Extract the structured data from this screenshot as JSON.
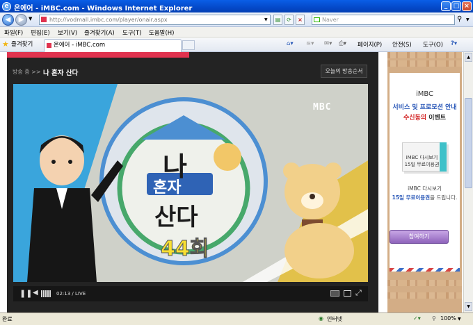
{
  "window": {
    "title": "온에어 - iMBC.com - Windows Internet Explorer"
  },
  "address": {
    "url": "http://vodmall.imbc.com/player/onair.aspx",
    "search_placeholder": "Naver"
  },
  "menu": [
    "파일(F)",
    "편집(E)",
    "보기(V)",
    "즐겨찾기(A)",
    "도구(T)",
    "도움말(H)"
  ],
  "favorites": {
    "label": "즐겨찾기",
    "tab_title": "온에어 - iMBC.com"
  },
  "commandbar": {
    "page": "페이지(P)",
    "safety": "안전(S)",
    "tools": "도구(O)"
  },
  "player": {
    "breadcrumb": "방송 중 >>",
    "show_title": "나 혼자 산다",
    "schedule_button": "오늘의 방송순서",
    "video": {
      "logo": "MBC",
      "title_line1": "나",
      "title_line2": "혼자",
      "title_line3": "산다",
      "episode": "44회"
    },
    "controls": {
      "time": "02:13 / LIVE"
    }
  },
  "ad": {
    "brand": "iMBC",
    "headline1": "서비스 및 프로모션 안내",
    "headline2_highlight": "수신동의",
    "headline2_rest": " 이벤트",
    "ticket_line1": "iMBC 다시보기",
    "ticket_line2": "15일 무료이용권",
    "desc_line1": "iMBC 다시보기",
    "desc_line2_highlight": "15일 무료이용권",
    "desc_line2_rest": "을 드립니다.",
    "button": "참여하기"
  },
  "status": {
    "left": "완료",
    "zone": "인터넷",
    "zoom": "100%"
  },
  "colors": {
    "accent_pink": "#e0334f",
    "ie_blue": "#0449c9",
    "ad_purple": "#8e63bb",
    "ad_blue": "#2a58b8",
    "ad_red": "#d42a2a"
  }
}
